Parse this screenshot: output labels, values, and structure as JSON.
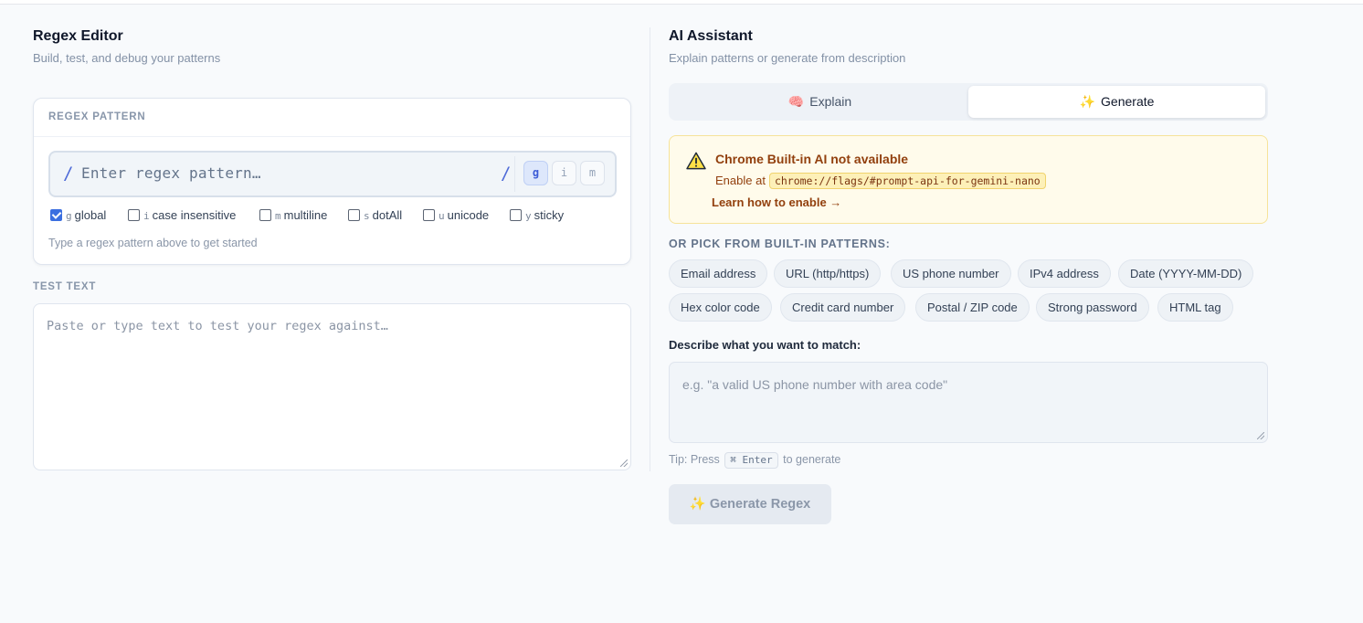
{
  "editor": {
    "title": "Regex Editor",
    "subtitle": "Build, test, and debug your patterns",
    "pattern_label": "REGEX PATTERN",
    "slash": "/",
    "pattern_placeholder": "Enter regex pattern…",
    "flag_buttons": [
      "g",
      "i",
      "m"
    ],
    "flags": [
      {
        "letter": "g",
        "label": "global",
        "checked": true
      },
      {
        "letter": "i",
        "label": "case insensitive",
        "checked": false
      },
      {
        "letter": "m",
        "label": "multiline",
        "checked": false
      },
      {
        "letter": "s",
        "label": "dotAll",
        "checked": false
      },
      {
        "letter": "u",
        "label": "unicode",
        "checked": false
      },
      {
        "letter": "y",
        "label": "sticky",
        "checked": false
      }
    ],
    "hint": "Type a regex pattern above to get started",
    "test_label": "TEST TEXT",
    "test_placeholder": "Paste or type text to test your regex against…"
  },
  "assistant": {
    "title": "AI Assistant",
    "subtitle": "Explain patterns or generate from description",
    "tabs": [
      {
        "icon": "🧠",
        "label": "Explain",
        "active": false
      },
      {
        "icon": "✨",
        "label": "Generate",
        "active": true
      }
    ],
    "warning": {
      "title": "Chrome Built-in AI not available",
      "enable_text": "Enable at",
      "flag_url": "chrome://flags/#prompt-api-for-gemini-nano",
      "link": "Learn how to enable →"
    },
    "pick_label": "OR PICK FROM BUILT-IN PATTERNS:",
    "patterns": [
      "Email address",
      "URL (http/https)",
      "US phone number",
      "IPv4 address",
      "Date (YYYY-MM-DD)",
      "Hex color code",
      "Credit card number",
      "Postal / ZIP code",
      "Strong password",
      "HTML tag"
    ],
    "describe_label": "Describe what you want to match:",
    "describe_placeholder": "e.g. \"a valid US phone number with area code\"",
    "tip_prefix": "Tip: Press",
    "tip_key": "⌘ Enter",
    "tip_suffix": "to generate",
    "generate_icon": "✨",
    "generate_button": "Generate Regex"
  }
}
